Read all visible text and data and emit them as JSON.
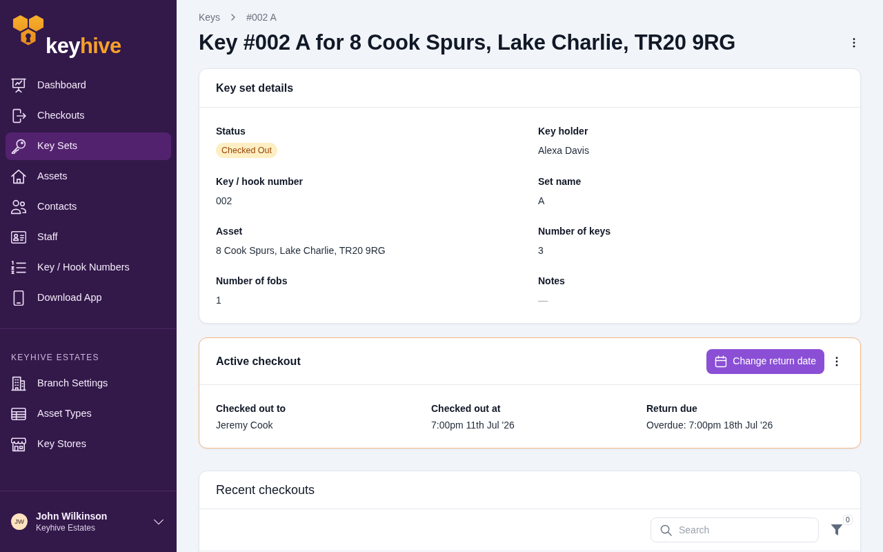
{
  "sidebar": {
    "logo_text": [
      "key",
      "hive"
    ],
    "nav_items": [
      {
        "label": "Dashboard",
        "selected": false
      },
      {
        "label": "Checkouts",
        "selected": false
      },
      {
        "label": "Key Sets",
        "selected": true
      },
      {
        "label": "Assets",
        "selected": false
      },
      {
        "label": "Contacts",
        "selected": false
      },
      {
        "label": "Staff",
        "selected": false
      },
      {
        "label": "Key / Hook Numbers",
        "selected": false
      },
      {
        "label": "Download App",
        "selected": false
      }
    ],
    "section_heading": "KEYHIVE ESTATES",
    "section_items": [
      {
        "label": "Branch Settings",
        "selected": false
      },
      {
        "label": "Asset Types",
        "selected": false
      },
      {
        "label": "Key Stores",
        "selected": false
      }
    ],
    "user": {
      "initials": "JW",
      "name": "John Wilkinson",
      "organisation": "Keyhive Estates"
    }
  },
  "breadcrumb": [
    "Keys",
    "#002 A"
  ],
  "page_title": "Key #002 A for 8 Cook Spurs, Lake Charlie, TR20 9RG",
  "key_set_details": {
    "title": "Key set details",
    "fields": [
      {
        "label": "Status",
        "value": "Checked Out",
        "kind": "badge"
      },
      {
        "label": "Key holder",
        "value": "Alexa Davis",
        "kind": "text"
      },
      {
        "label": "Key / hook number",
        "value": "002",
        "kind": "text"
      },
      {
        "label": "Set name",
        "value": "A",
        "kind": "text"
      },
      {
        "label": "Asset",
        "value": "8 Cook Spurs, Lake Charlie, TR20 9RG",
        "kind": "text"
      },
      {
        "label": "Number of keys",
        "value": "3",
        "kind": "text"
      },
      {
        "label": "Number of fobs",
        "value": "1",
        "kind": "text"
      },
      {
        "label": "Notes",
        "value": "—",
        "kind": "muted"
      }
    ]
  },
  "active_checkout": {
    "title": "Active checkout",
    "overdue": true,
    "button": "Change return date",
    "fields": [
      {
        "label": "Checked out to",
        "value": "Jeremy Cook"
      },
      {
        "label": "Checked out at",
        "value": "7:00pm 11th Jul '26"
      },
      {
        "label": "Return due",
        "value": "Overdue: 7:00pm 18th Jul '26"
      }
    ]
  },
  "recent_checkouts": {
    "title": "Recent checkouts",
    "search": {
      "placeholder": "Search"
    },
    "filter_count": "0"
  }
}
